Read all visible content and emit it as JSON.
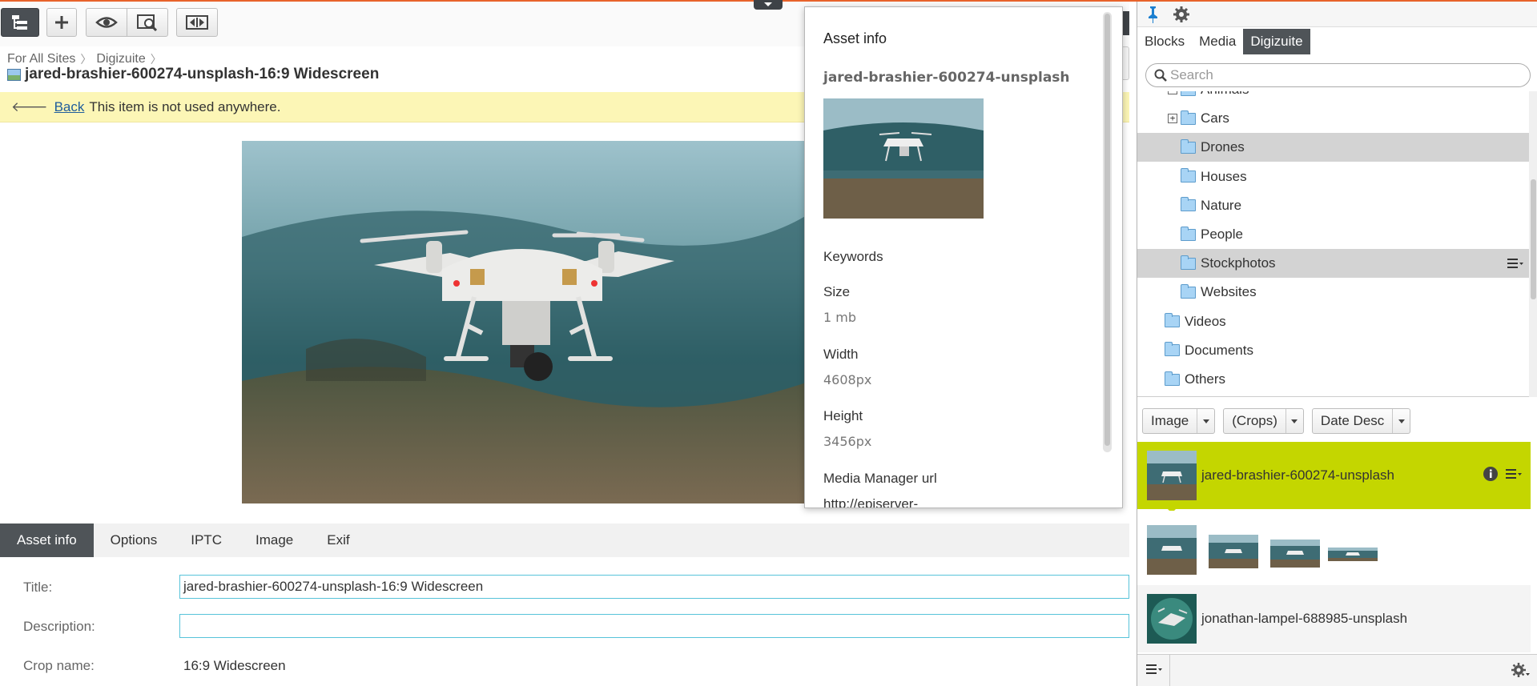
{
  "toolbar": {
    "buttons": [
      "navigation-tree-toggle",
      "add",
      "preview",
      "compare",
      "toggle-panes"
    ]
  },
  "breadcrumb": {
    "items": [
      "For All Sites",
      "Digizuite"
    ]
  },
  "page": {
    "title": "jared-brashier-600274-unsplash-16:9 Widescreen"
  },
  "notice": {
    "back_label": "Back",
    "message": "This item is not used anywhere."
  },
  "tabs": [
    "Asset info",
    "Options",
    "IPTC",
    "Image",
    "Exif"
  ],
  "form": {
    "title_label": "Title:",
    "title_value": "jared-brashier-600274-unsplash-16:9 Widescreen",
    "description_label": "Description:",
    "description_value": "",
    "crop_label": "Crop name:",
    "crop_value": "16:9 Widescreen"
  },
  "popup": {
    "heading": "Asset info",
    "asset_name": "jared-brashier-600274-unsplash",
    "keywords_label": "Keywords",
    "size_label": "Size",
    "size_value": "1 mb",
    "width_label": "Width",
    "width_value": "4608px",
    "height_label": "Height",
    "height_value": "3456px",
    "mm_url_label": "Media Manager url",
    "mm_url_value": "http://episerver-"
  },
  "right_panel": {
    "tabs": [
      "Blocks",
      "Media",
      "Digizuite"
    ],
    "active_tab": "Digizuite",
    "search_placeholder": "Search",
    "tree": [
      {
        "label": "Animals",
        "expander": "−",
        "indent": 1,
        "highlight": false
      },
      {
        "label": "Cars",
        "expander": "+",
        "indent": 1,
        "highlight": false
      },
      {
        "label": "Drones",
        "expander": "",
        "indent": 1,
        "highlight": true
      },
      {
        "label": "Houses",
        "expander": "",
        "indent": 1,
        "highlight": false
      },
      {
        "label": "Nature",
        "expander": "",
        "indent": 1,
        "highlight": false
      },
      {
        "label": "People",
        "expander": "",
        "indent": 1,
        "highlight": false
      },
      {
        "label": "Stockphotos",
        "expander": "",
        "indent": 1,
        "highlight": true
      },
      {
        "label": "Websites",
        "expander": "",
        "indent": 1,
        "highlight": false
      },
      {
        "label": "Videos",
        "expander": "",
        "indent": 0,
        "highlight": false
      },
      {
        "label": "Documents",
        "expander": "",
        "indent": 0,
        "highlight": false
      },
      {
        "label": "Others",
        "expander": "",
        "indent": 0,
        "highlight": false
      }
    ],
    "filters": {
      "type": "Image",
      "crops": "(Crops)",
      "sort": "Date Desc"
    },
    "assets": [
      {
        "name": "jared-brashier-600274-unsplash",
        "selected": true
      },
      {
        "name": "jonathan-lampel-688985-unsplash",
        "selected": false
      }
    ]
  },
  "colors": {
    "accent_top": "#e8632b",
    "selected_row": "#c4d600",
    "active_tab": "#4f5458",
    "notice_bg": "#fcf6b6"
  }
}
